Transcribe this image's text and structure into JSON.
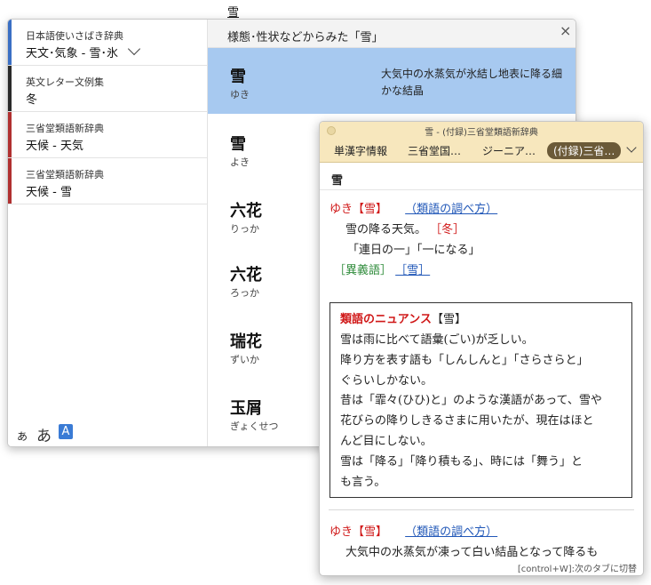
{
  "top_character": "雪",
  "sidebar": {
    "items": [
      {
        "dict": "日本語使いさばき辞典",
        "topic": "天文･気象 - 雪･氷",
        "color": "#3a6fc4"
      },
      {
        "dict": "英文レター文例集",
        "topic": "冬",
        "color": "#2a2a2a"
      },
      {
        "dict": "三省堂類語新辞典",
        "topic": "天候 - 天気",
        "color": "#b03030"
      },
      {
        "dict": "三省堂類語新辞典",
        "topic": "天候 - 雪",
        "color": "#b03030"
      }
    ],
    "kana_small": "あ",
    "kana_large": "あ",
    "font_button": "A"
  },
  "results": {
    "title": "様態･性状などからみた「雪」",
    "close": "×",
    "items": [
      {
        "word": "雪",
        "reading": "ゆき",
        "desc": "大気中の水蒸気が氷結し地表に降る細かな結晶"
      },
      {
        "word": "雪",
        "reading": "よき",
        "desc": ""
      },
      {
        "word": "六花",
        "reading": "りっか",
        "desc": ""
      },
      {
        "word": "六花",
        "reading": "ろっか",
        "desc": ""
      },
      {
        "word": "瑞花",
        "reading": "ずいか",
        "desc": ""
      },
      {
        "word": "玉屑",
        "reading": "ぎょくせつ",
        "desc": ""
      }
    ]
  },
  "popup": {
    "window_title": "雪 - (付録)三省堂類語新辞典",
    "tabs": [
      "単漢字情報",
      "三省堂国…",
      "ジーニア…",
      "(付録)三省…"
    ],
    "headword": "雪",
    "entry1": {
      "head": "ゆき【雪】",
      "link": "（類語の調べ方）",
      "def": "雪の降る天気。",
      "tag": "［冬］",
      "example": "「連日の一」「一になる」",
      "syn_label": "［異義語］",
      "syn_link": "［雪］"
    },
    "nuance": {
      "title": "類語のニュアンス",
      "title_word": "【雪】",
      "lines": [
        "雪は雨に比べて語彙(ごい)が乏しい。",
        "降り方を表す語も「しんしんと」「さらさらと」",
        "ぐらいしかない。",
        "昔は「霏々(ひひ)と」のような漢語があって、雪や",
        "花びらの降りしきるさまに用いたが、現在はほと",
        "んど目にしない。",
        "雪は「降る」「降り積もる」、時には「舞う」と",
        "も言う。"
      ]
    },
    "entry2": {
      "head": "ゆき【雪】",
      "link": "（類語の調べ方）",
      "def": "大気中の水蒸気が凍って白い結晶となって降るも"
    },
    "footer_hint": "[control+W]:次のタブに切替"
  }
}
